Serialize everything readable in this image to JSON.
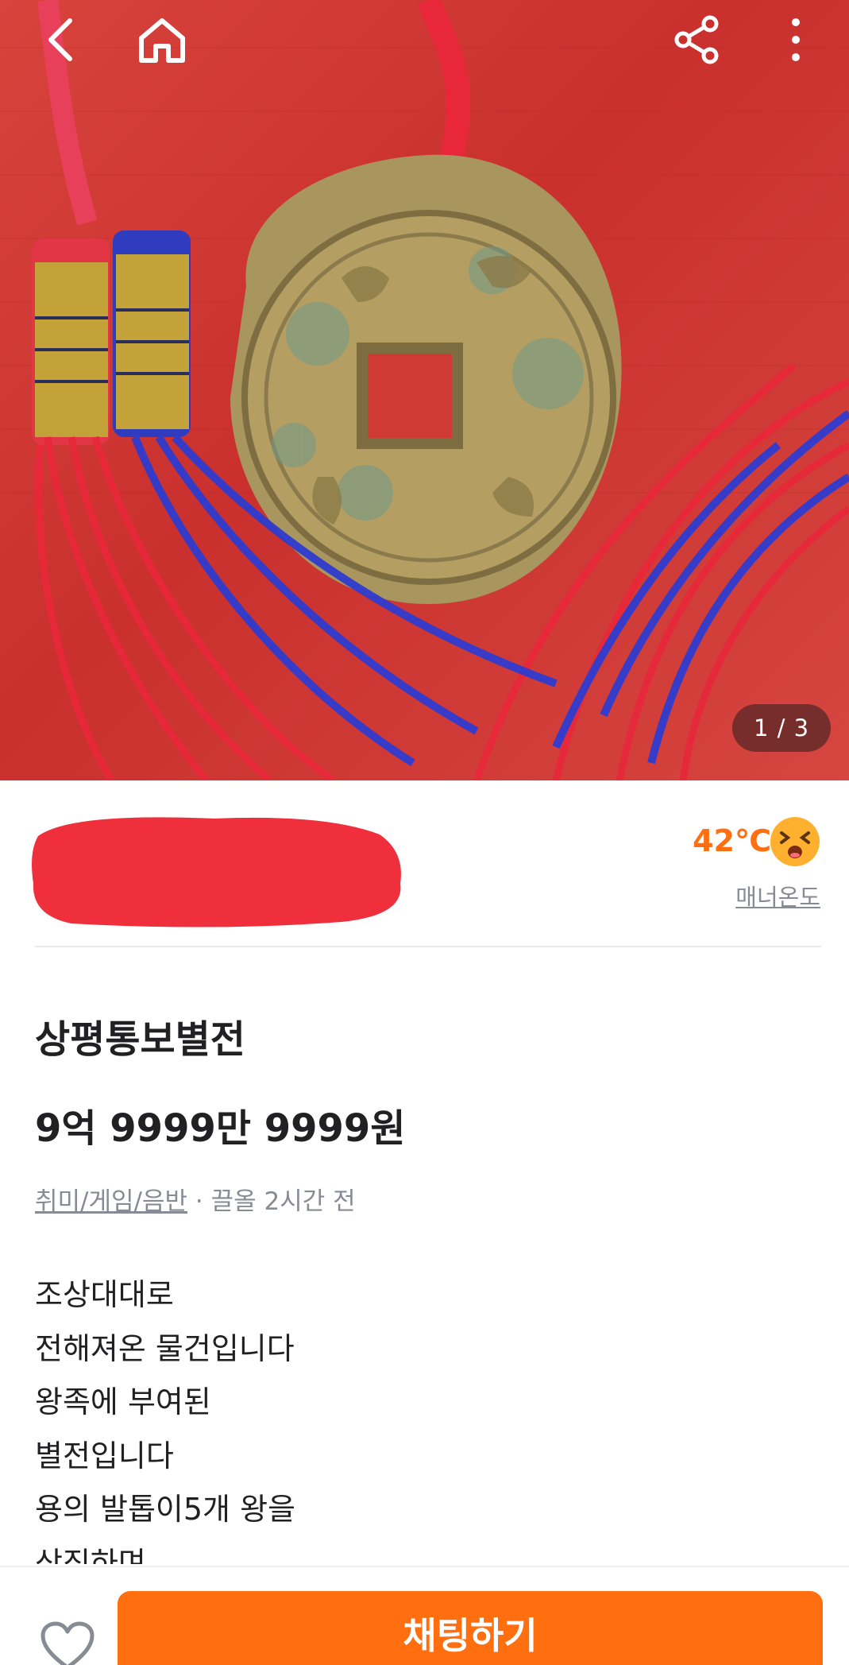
{
  "product": {
    "image_counter": "1 / 3",
    "title": "상평통보별전",
    "price": "9억 9999만 9999원",
    "category": "취미/게임/음반",
    "location_time": " · 끌올 2시간 전",
    "description_lines": [
      "조상대대로",
      "전해져온 물건입니다",
      "왕족에 부여된",
      "별전입니다",
      "용의 발톱이5개 왕을",
      "상징하며"
    ]
  },
  "seller": {
    "manner_temp": "42℃",
    "manner_label": "매너온도"
  },
  "actions": {
    "chat_label": "채팅하기"
  },
  "icons": {
    "back": "back-arrow-icon",
    "home": "home-icon",
    "share": "share-icon",
    "more": "more-vertical-icon",
    "like": "heart-icon",
    "temp_face": "smiley-face-icon"
  },
  "colors": {
    "accent": "#ff6f0f",
    "muted_text": "#868b94",
    "hero_bg": "#d0393a"
  }
}
